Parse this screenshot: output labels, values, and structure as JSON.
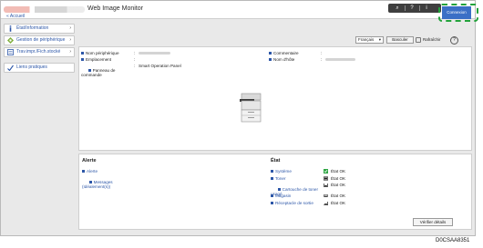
{
  "header": {
    "app_title": "Web Image Monitor",
    "breadcrumb": "« Accueil",
    "toolbar": {
      "search_glyph": "⌕",
      "help_glyph": "?",
      "info_glyph": "i"
    },
    "login_label": "Connexion"
  },
  "sidebar": {
    "items": [
      {
        "label": "État/Information",
        "icon": "info-icon"
      },
      {
        "label": "Gestion de périphérique",
        "icon": "device-management-icon"
      },
      {
        "label": "Trav.impr./Fich.stocké",
        "icon": "print-jobs-icon"
      },
      {
        "label": "Liens pratiques",
        "icon": "links-icon"
      }
    ],
    "arrow": "›"
  },
  "controls": {
    "language": "Français",
    "switch_label": "Basculer",
    "refresh_label": "Rafraîchir",
    "help_label": "?"
  },
  "device_info": {
    "left": [
      {
        "label": "Nom périphérique",
        "value": ""
      },
      {
        "label": "Emplacement",
        "value": ""
      },
      {
        "label": "Panneau de\ncommande",
        "value": "Smart Operation Panel"
      }
    ],
    "right": [
      {
        "label": "Commentaire",
        "value": ""
      },
      {
        "label": "Nom d'hôte",
        "value": ""
      }
    ],
    "separator": ":"
  },
  "alert": {
    "title": "Alerte",
    "links": [
      "Alerte",
      "Messages\n(Idéalement(s))"
    ]
  },
  "status": {
    "title": "État",
    "rows": [
      {
        "label": "Système",
        "value": "État OK",
        "icon": "system-ok-icon"
      },
      {
        "label": "Toner",
        "value": "État OK",
        "icon": "toner-icon"
      },
      {
        "label": "Cartouche de toner\nusagé",
        "value": "État OK",
        "icon": "waste-toner-icon"
      },
      {
        "label": "Magasin",
        "value": "État OK",
        "icon": "tray-icon"
      },
      {
        "label": "Réceptacle de sortie",
        "value": "État OK",
        "icon": "output-tray-icon"
      }
    ],
    "check_label": "Vérifier détails"
  },
  "doc_id": "D0CSAA8351",
  "colors": {
    "accent": "#2d57a8",
    "login": "#3b6fc6",
    "highlight": "#22a23b"
  }
}
